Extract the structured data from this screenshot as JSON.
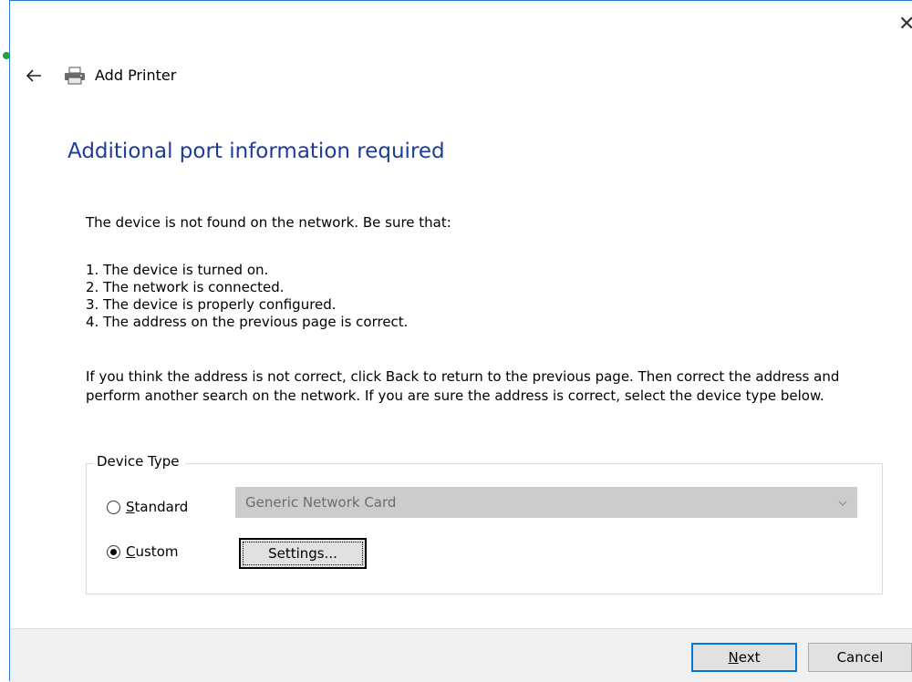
{
  "window": {
    "title": "Add Printer",
    "close_icon": "close-icon",
    "back_icon": "back-arrow-icon",
    "printer_icon": "printer-icon"
  },
  "page": {
    "heading": "Additional port information required",
    "intro": "The device is not found on the network.  Be sure that:",
    "steps": [
      "1.  The device is turned on.",
      "2.  The network is connected.",
      "3.  The device is properly configured.",
      "4.  The address on the previous page is correct."
    ],
    "explain": "If you think the address is not correct, click Back to return to the previous page.  Then correct the address and perform another search on the network.  If you are sure the address is correct, select the device type below."
  },
  "device_type": {
    "legend": "Device Type",
    "standard_label": "Standard",
    "custom_label": "Custom",
    "selected": "Custom",
    "standard_select_value": "Generic Network Card",
    "settings_label": "Settings..."
  },
  "footer": {
    "next_label": "Next",
    "cancel_label": "Cancel"
  },
  "colors": {
    "heading": "#1e3c96",
    "accent": "#0078d7",
    "border": "#2b79d0"
  }
}
